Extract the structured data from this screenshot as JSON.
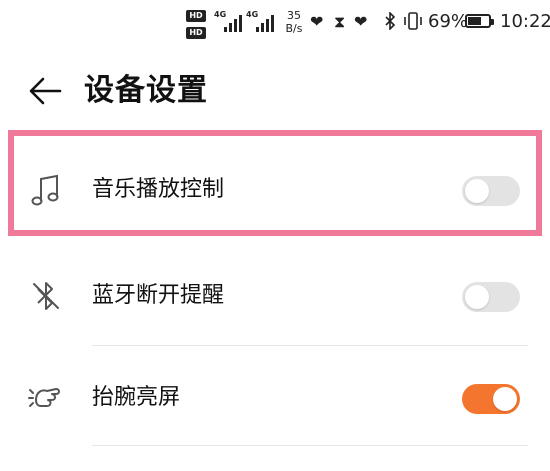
{
  "status_bar": {
    "hd_top": "HD",
    "hd_bottom": "HD",
    "signal1_tag": "4G",
    "signal2_tag": "4G",
    "speed_value": "35",
    "speed_unit": "B/s",
    "battery_percent": "69%",
    "battery_level": 0.69,
    "time": "10:22",
    "icons": [
      "hd-icon",
      "signal-icon",
      "heart-rate-icon",
      "hourglass-icon",
      "heart-rate-icon",
      "bluetooth-icon",
      "vibrate-icon",
      "battery-icon"
    ]
  },
  "header": {
    "title": "设备设置"
  },
  "settings": {
    "items": [
      {
        "label": "音乐播放控制",
        "icon": "music-note-icon",
        "enabled": false
      },
      {
        "label": "蓝牙断开提醒",
        "icon": "bluetooth-off-icon",
        "enabled": false
      },
      {
        "label": "抬腕亮屏",
        "icon": "raise-wrist-icon",
        "enabled": true
      }
    ]
  },
  "colors": {
    "accent": "#f4762e",
    "toggle_off": "#e3e3e3",
    "highlight": "#f07898"
  }
}
